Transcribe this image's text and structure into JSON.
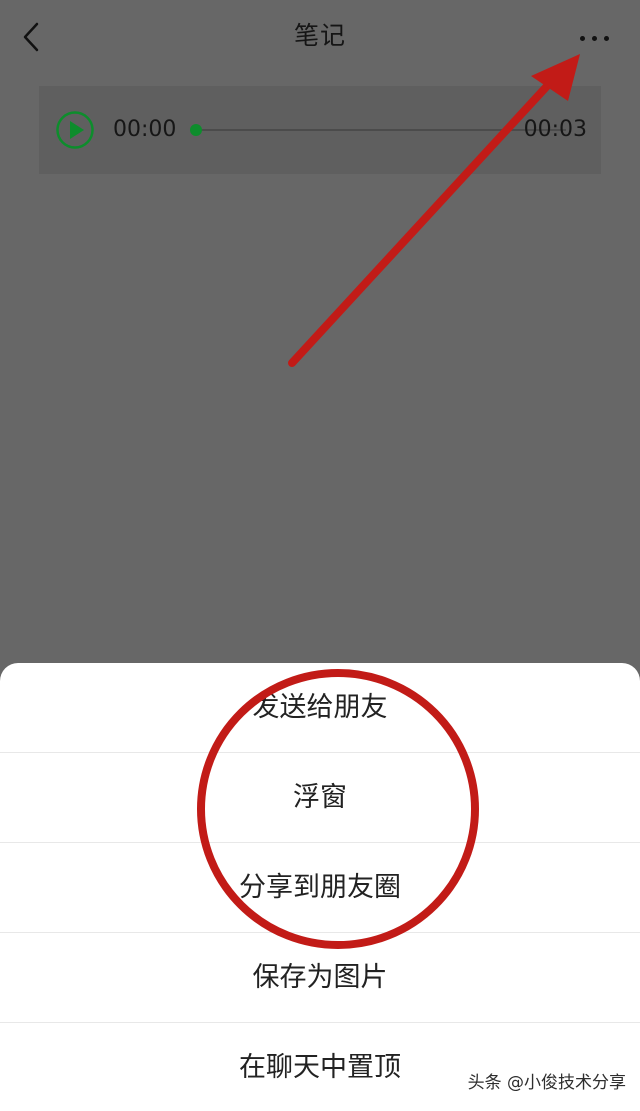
{
  "title": "笔记",
  "icons": {
    "back": "chevron-left-icon",
    "more": "more-horizontal-icon",
    "play": "play-icon"
  },
  "audio": {
    "current_time": "00:00",
    "total_time": "00:03"
  },
  "sheet": {
    "items": [
      {
        "label": "发送给朋友"
      },
      {
        "label": "浮窗"
      },
      {
        "label": "分享到朋友圈"
      },
      {
        "label": "保存为图片"
      },
      {
        "label": "在聊天中置顶"
      }
    ]
  },
  "watermark": "头条 @小俊技术分享",
  "colors": {
    "background_dim": "#676767",
    "play_green": "#0d8d2c",
    "annotation_red": "#c21b17"
  }
}
